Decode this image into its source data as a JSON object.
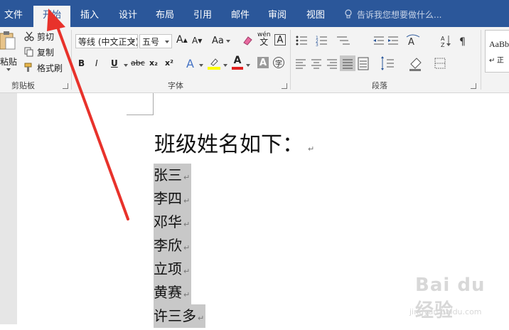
{
  "menubar": {
    "tabs": [
      "文件",
      "开始",
      "插入",
      "设计",
      "布局",
      "引用",
      "邮件",
      "审阅",
      "视图"
    ],
    "active_tab": "开始",
    "tell_me": "告诉我您想要做什么...",
    "accent_color": "#2b579a"
  },
  "clipboard": {
    "paste": "粘贴",
    "cut": "剪切",
    "copy": "复制",
    "format_painter": "格式刷",
    "group_label": "剪贴板"
  },
  "font": {
    "font_name": "等线 (中文正文)",
    "font_size": "五号",
    "grow_label": "A",
    "shrink_label": "A",
    "change_case": "Aa",
    "bold": "B",
    "italic": "I",
    "underline": "U",
    "strikethrough": "abc",
    "subscript": "x₂",
    "superscript": "x²",
    "phonetic_top": "wén",
    "phonetic_bottom": "文",
    "char_border": "A",
    "text_effect": "A",
    "font_color": "A",
    "char_shading": "A",
    "enclose": "字",
    "group_label": "字体",
    "font_color_value": "#e02020",
    "highlight_color_value": "#ffff00"
  },
  "paragraph": {
    "group_label": "段落"
  },
  "styles": {
    "preview": "AaBb",
    "preview2": "↵ 正"
  },
  "document": {
    "heading": "班级姓名如下：",
    "names": [
      "张三",
      "李四",
      "邓华",
      "李欣",
      "立项",
      "黄赛",
      "许三多"
    ],
    "pilcrow": "↵"
  },
  "watermark": {
    "big": "Bai du 经验",
    "small": "jingyan.baidu.com"
  }
}
